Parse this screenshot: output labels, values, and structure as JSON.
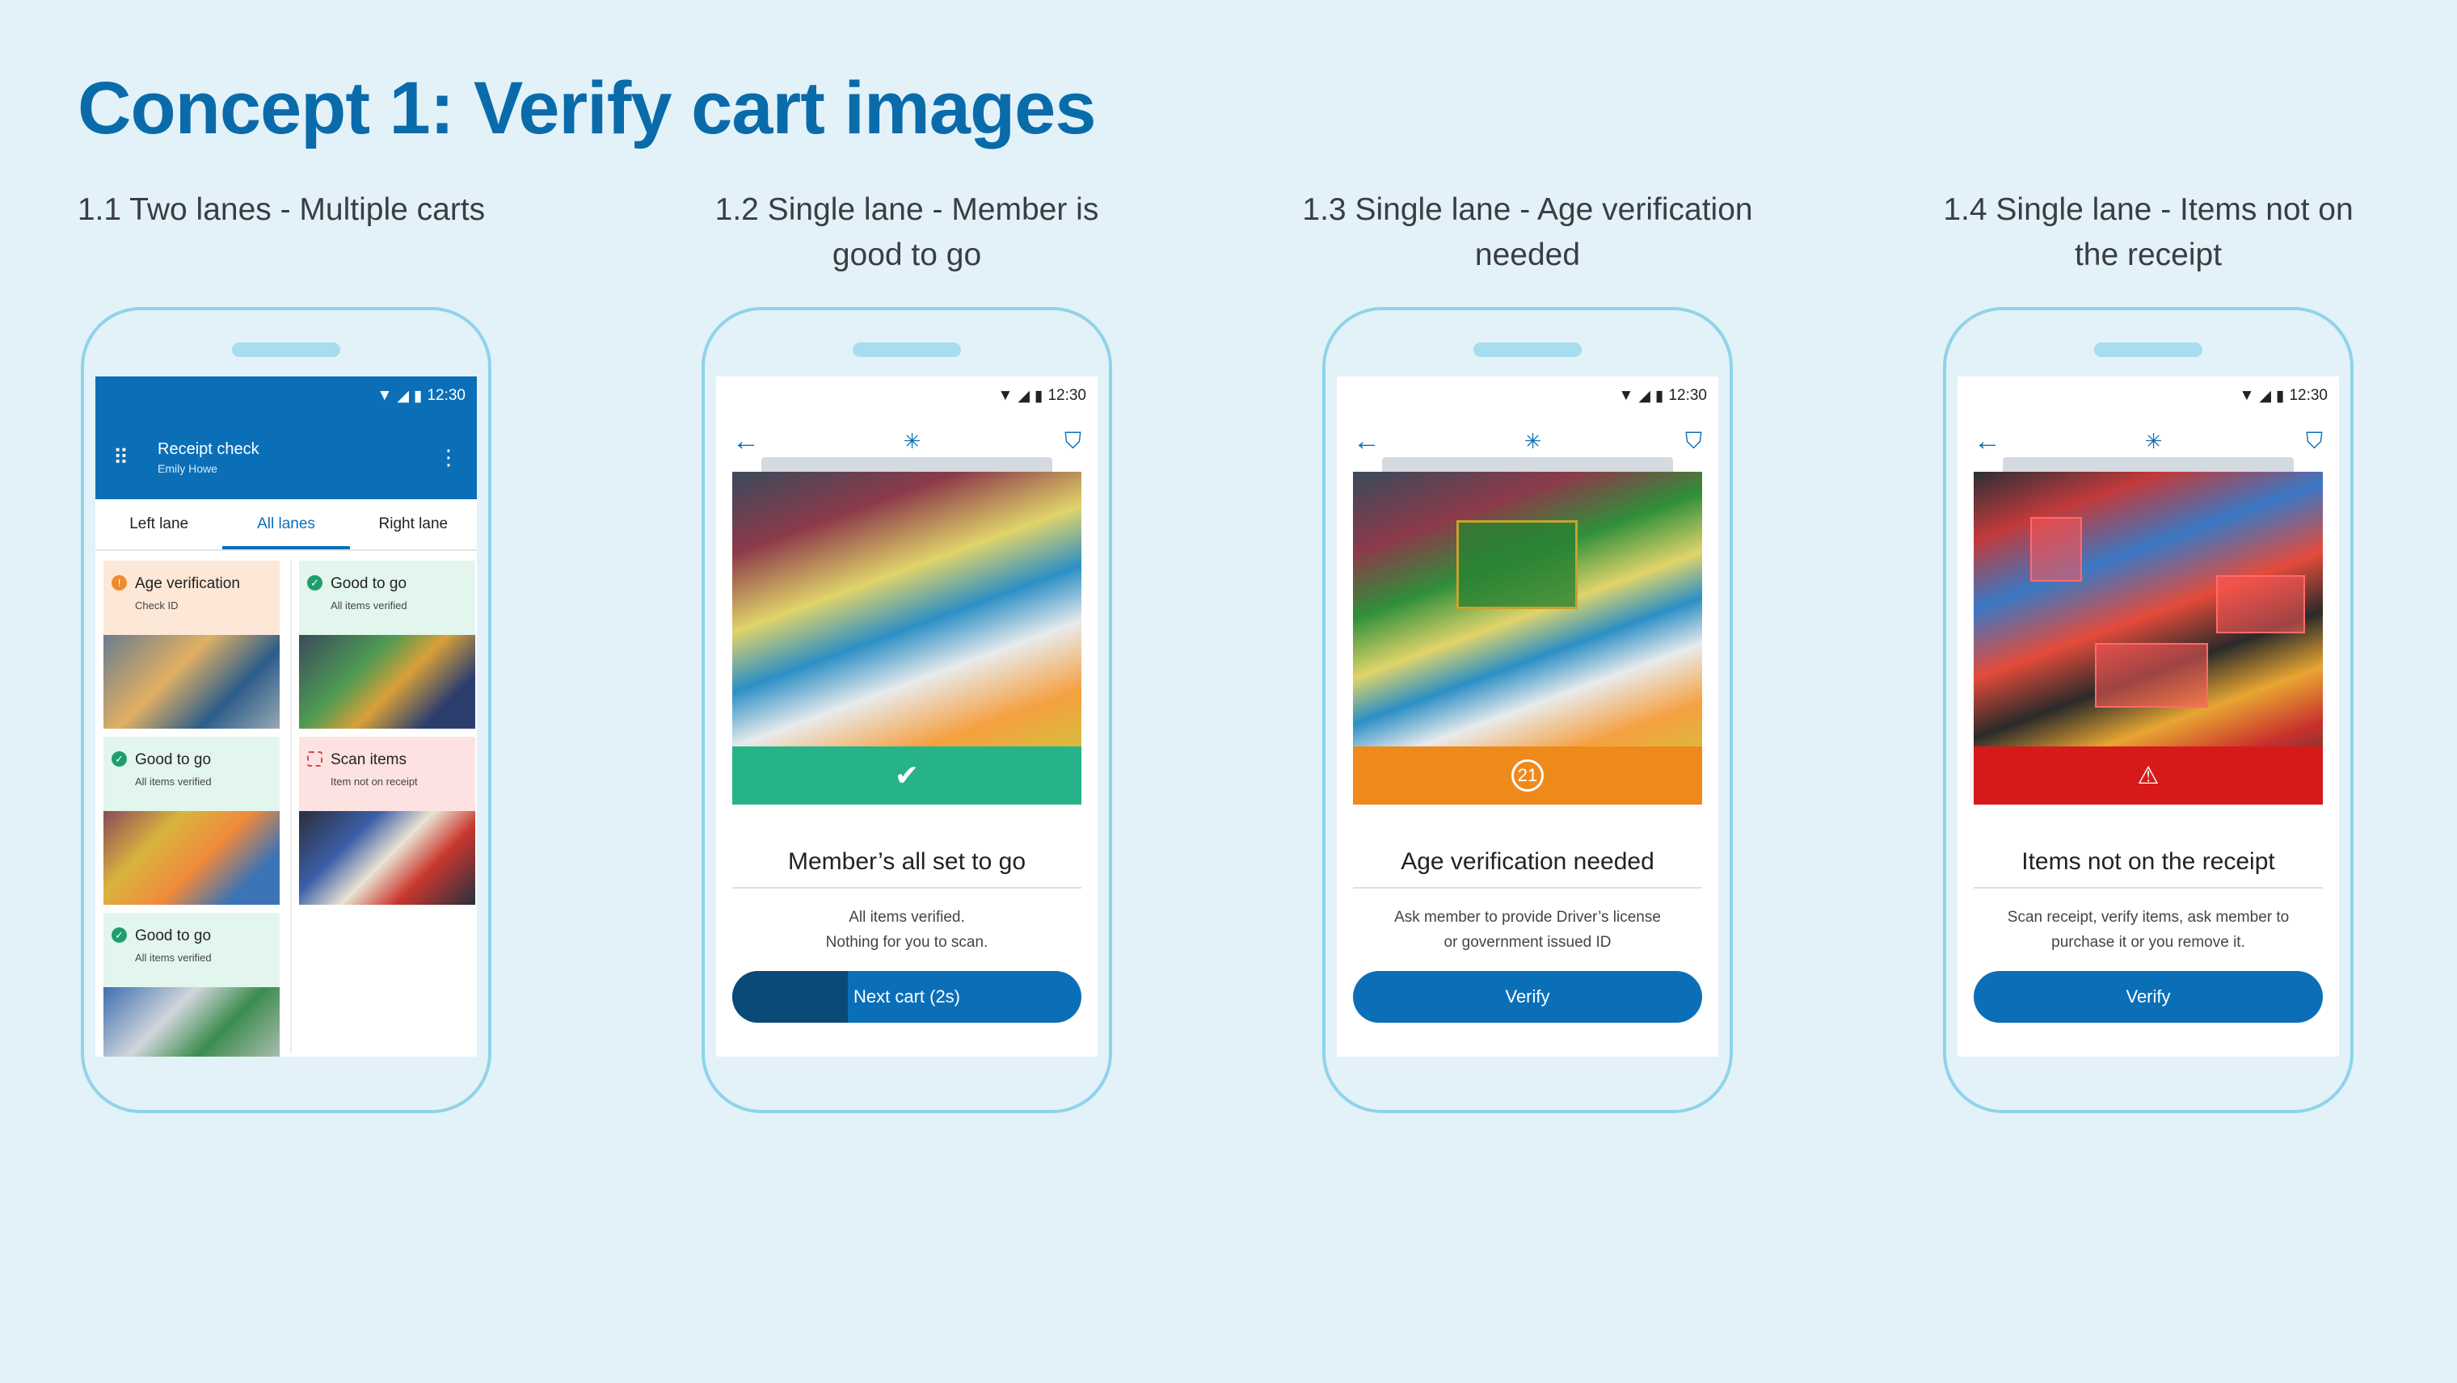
{
  "title": "Concept 1: Verify cart images",
  "captions": [
    "1.1 Two lanes - Multiple carts",
    "1.2 Single lane - Member is good to go",
    "1.3 Single lane - Age verification needed",
    "1.4 Single lane - Items not on the receipt"
  ],
  "status_time": "12:30",
  "phone1": {
    "app_title": "Receipt check",
    "app_user": "Emily Howe",
    "tabs": [
      "Left lane",
      "All lanes",
      "Right lane"
    ],
    "active_tab": "All lanes",
    "cards": [
      {
        "title": "Age verification",
        "sub": "Check ID",
        "tone": "orange"
      },
      {
        "title": "Good to go",
        "sub": "All items verified",
        "tone": "green"
      },
      {
        "title": "Good to go",
        "sub": "All items verified",
        "tone": "green"
      },
      {
        "title": "Scan items",
        "sub": "Item not on receipt",
        "tone": "red"
      },
      {
        "title": "Good to go",
        "sub": "All items verified",
        "tone": "green"
      }
    ]
  },
  "phone2": {
    "heading": "Member’s all set to go",
    "body_line1": "All items verified.",
    "body_line2": "Nothing for you to scan.",
    "button": "Next cart (2s)",
    "button_progress": 0.33,
    "band_color": "#27b38a"
  },
  "phone3": {
    "heading": "Age verification needed",
    "body_line1": "Ask member to provide Driver’s license",
    "body_line2": "or government issued ID",
    "button": "Verify",
    "band_color": "#ee8a1c",
    "badge": "21"
  },
  "phone4": {
    "heading": "Items not on the receipt",
    "body_line1": "Scan receipt, verify items, ask member to",
    "body_line2": "purchase it or you remove it.",
    "button": "Verify",
    "band_color": "#d61a1a"
  },
  "colors": {
    "brand": "#0b6fb8",
    "title": "#0a6bab",
    "background": "#e2f2f8",
    "phone_outline": "#8fd3ea"
  }
}
